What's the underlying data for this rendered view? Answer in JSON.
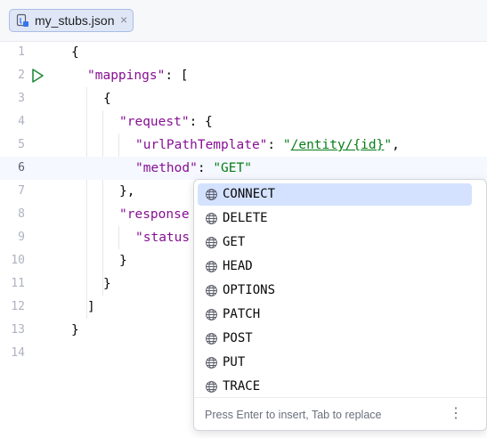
{
  "tab": {
    "filename": "my_stubs.json",
    "file_icon": "json-file-icon",
    "close_glyph": "×"
  },
  "gutter": {
    "line_numbers": [
      "1",
      "2",
      "3",
      "4",
      "5",
      "6",
      "7",
      "8",
      "9",
      "10",
      "11",
      "12",
      "13",
      "14"
    ],
    "run_icon": "run-triangle-icon"
  },
  "code": {
    "l1": {
      "p0": "{"
    },
    "l2": {
      "key": "\"mappings\"",
      "p1": ": ["
    },
    "l3": {
      "p0": "{"
    },
    "l4": {
      "key": "\"request\"",
      "p1": ": {"
    },
    "l5": {
      "key": "\"urlPathTemplate\"",
      "p1": ": ",
      "q1": "\"",
      "path": "/entity/{id}",
      "q2": "\"",
      "p2": ","
    },
    "l6": {
      "key": "\"method\"",
      "p1": ": ",
      "val": "\"GET\""
    },
    "l7": {
      "p0": "},"
    },
    "l8": {
      "key": "\"response"
    },
    "l9": {
      "key": "\"status"
    },
    "l10": {
      "p0": "}"
    },
    "l11": {
      "p0": "}"
    },
    "l12": {
      "p0": "]"
    },
    "l13": {
      "p0": "}"
    }
  },
  "completion": {
    "items": [
      "CONNECT",
      "DELETE",
      "GET",
      "HEAD",
      "OPTIONS",
      "PATCH",
      "POST",
      "PUT",
      "TRACE"
    ],
    "item_icon": "globe-icon",
    "selected": "CONNECT",
    "hint": "Press Enter to insert, Tab to replace",
    "more_glyph": "⋮"
  },
  "colors": {
    "key": "#871094",
    "string": "#067d17",
    "selection": "#d4e2ff",
    "current_line": "#f5f8fe"
  }
}
